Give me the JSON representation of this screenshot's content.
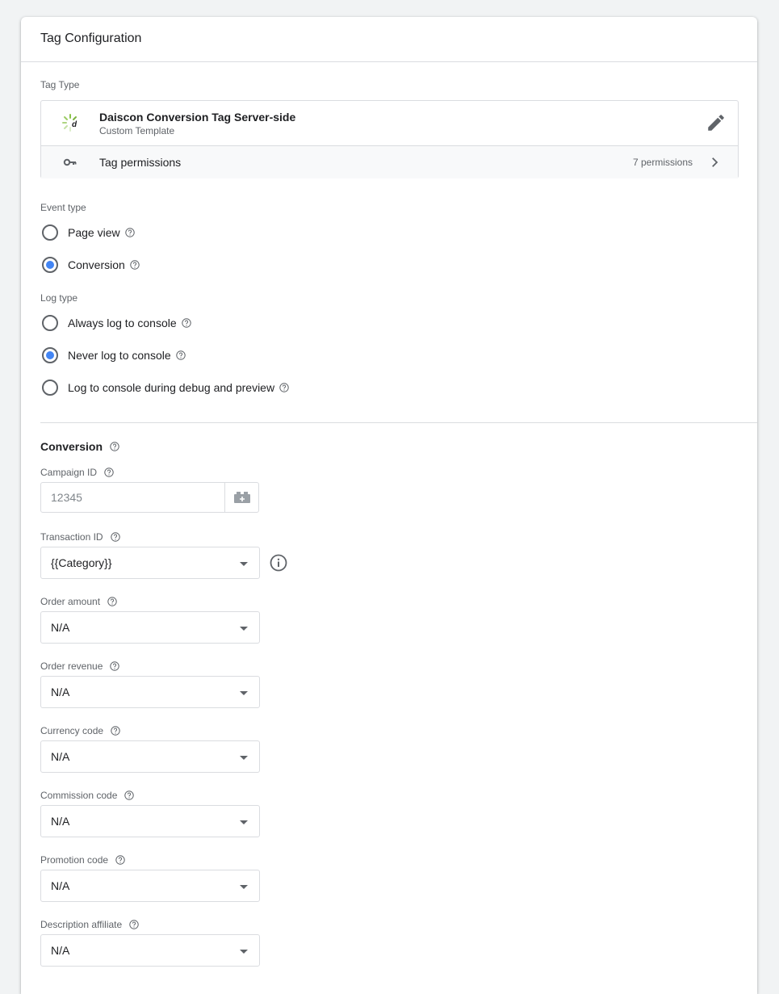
{
  "card": {
    "title": "Tag Configuration"
  },
  "tag_type": {
    "section_label": "Tag Type",
    "template_name": "Daiscon Conversion Tag Server-side",
    "template_sub": "Custom Template",
    "permissions_label": "Tag permissions",
    "permissions_count": "7 permissions"
  },
  "event_type": {
    "label": "Event type",
    "options": [
      "Page view",
      "Conversion"
    ],
    "selected": "Conversion"
  },
  "log_type": {
    "label": "Log type",
    "options": [
      "Always log to console",
      "Never log to console",
      "Log to console during debug and preview"
    ],
    "selected": "Never log to console"
  },
  "conversion": {
    "title": "Conversion",
    "campaign_id": {
      "label": "Campaign ID",
      "placeholder": "12345",
      "value": ""
    },
    "transaction_id": {
      "label": "Transaction ID",
      "value": "{{Category}}"
    },
    "order_amount": {
      "label": "Order amount",
      "value": "N/A"
    },
    "order_revenue": {
      "label": "Order revenue",
      "value": "N/A"
    },
    "currency_code": {
      "label": "Currency code",
      "value": "N/A"
    },
    "commission_code": {
      "label": "Commission code",
      "value": "N/A"
    },
    "promotion_code": {
      "label": "Promotion code",
      "value": "N/A"
    },
    "description_affiliate": {
      "label": "Description affiliate",
      "value": "N/A"
    }
  },
  "colors": {
    "accent": "#4285f4",
    "text": "#202124",
    "muted": "#5f6368",
    "border": "#dadce0",
    "page_bg": "#f1f3f4"
  },
  "icons": [
    "daiscon-logo",
    "pencil-icon",
    "key-icon",
    "chevron-right-icon",
    "help-icon",
    "variable-picker-icon",
    "info-icon",
    "dropdown-caret-icon"
  ]
}
